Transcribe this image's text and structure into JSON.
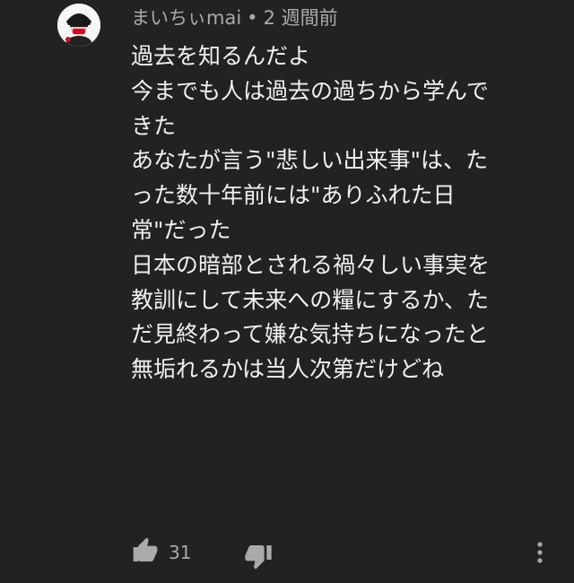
{
  "comment": {
    "author": "まいちぃmai",
    "separator": "•",
    "timestamp": "2 週間前",
    "avatar_icon": "avatar-icon",
    "lines": [
      "過去を知るんだよ",
      "今までも人は過去の過ちから学んで",
      "きた",
      "あなたが言う\"悲しい出来事\"は、た",
      "った数十年前には\"ありふれた日",
      "常\"だった",
      "日本の暗部とされる禍々しい事実を",
      "教訓にして未来への糧にするか、た",
      "だ見終わって嫌な気持ちになったと",
      "無垢れるかは当人次第だけどね"
    ]
  },
  "actions": {
    "like_count": "31",
    "like_icon": "thumbs-up-icon",
    "dislike_icon": "thumbs-down-icon",
    "more_icon": "more-vertical-icon"
  },
  "colors": {
    "background": "#222222",
    "text_primary": "#f1f1f1",
    "text_secondary": "#aaaaaa"
  }
}
